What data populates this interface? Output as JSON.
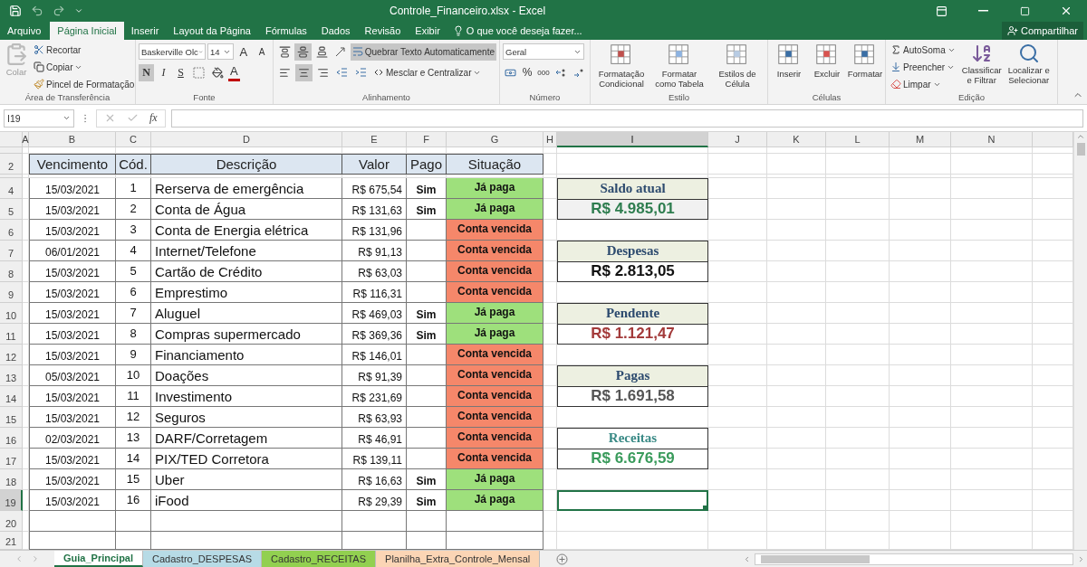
{
  "window": {
    "title": "Controle_Financeiro.xlsx - Excel"
  },
  "menu_tabs": [
    {
      "label": "Arquivo",
      "selected": false,
      "kind": "file"
    },
    {
      "label": "Página Inicial",
      "selected": true,
      "kind": "tab"
    },
    {
      "label": "Inserir",
      "selected": false,
      "kind": "tab"
    },
    {
      "label": "Layout da Página",
      "selected": false,
      "kind": "tab"
    },
    {
      "label": "Fórmulas",
      "selected": false,
      "kind": "tab"
    },
    {
      "label": "Dados",
      "selected": false,
      "kind": "tab"
    },
    {
      "label": "Revisão",
      "selected": false,
      "kind": "tab"
    },
    {
      "label": "Exibir",
      "selected": false,
      "kind": "tab"
    }
  ],
  "tell_me": "O que você deseja fazer...",
  "share": "Compartilhar",
  "ribbon": {
    "clipboard": {
      "paste": "Colar",
      "cut": "Recortar",
      "copy": "Copiar",
      "format_painter": "Pincel de Formatação",
      "label": "Área de Transferência"
    },
    "font": {
      "font_name": "Baskerville Olc",
      "font_size": "14",
      "grow_font": "A",
      "shrink_font": "A",
      "bold": {
        "label": "N",
        "selected": true
      },
      "italic": {
        "label": "I",
        "selected": false
      },
      "underline": {
        "label": "S",
        "selected": false
      },
      "font_color": "A",
      "label": "Fonte"
    },
    "alignment": {
      "vertical_align": [
        {
          "selected": false
        },
        {
          "selected": true
        },
        {
          "selected": false
        }
      ],
      "horizontal_align": [
        {
          "selected": false
        },
        {
          "selected": true
        },
        {
          "selected": false
        }
      ],
      "wrap_text": {
        "label": "Quebrar Texto Automaticamente",
        "selected": true
      },
      "merge": "Mesclar e Centralizar",
      "label": "Alinhamento"
    },
    "number": {
      "format": "Geral",
      "percent": "%",
      "thousands": "000",
      "label": "Número"
    },
    "styles": {
      "buttons": [
        "Formatação Condicional",
        "Formatar como Tabela",
        "Estilos de Célula"
      ],
      "label": "Estilo"
    },
    "cells": {
      "buttons": [
        "Inserir",
        "Excluir",
        "Formatar"
      ],
      "label": "Células"
    },
    "editing": {
      "autosum": "AutoSoma",
      "fill": "Preencher",
      "clear": "Limpar",
      "sort": "Classificar e Filtrar",
      "find": "Localizar e Selecionar",
      "label": "Edição"
    }
  },
  "formula_bar": {
    "name_box": "I19",
    "function_label": "fx"
  },
  "column_headers": [
    {
      "label": "A",
      "selected": false
    },
    {
      "label": "B",
      "selected": false
    },
    {
      "label": "C",
      "selected": false
    },
    {
      "label": "D",
      "selected": false
    },
    {
      "label": "E",
      "selected": false
    },
    {
      "label": "F",
      "selected": false
    },
    {
      "label": "G",
      "selected": false
    },
    {
      "label": "H",
      "selected": false
    },
    {
      "label": "I",
      "selected": true
    },
    {
      "label": "J",
      "selected": false
    },
    {
      "label": "K",
      "selected": false
    },
    {
      "label": "L",
      "selected": false
    },
    {
      "label": "M",
      "selected": false
    },
    {
      "label": "N",
      "selected": false
    }
  ],
  "row_headers": [
    {
      "label": "2",
      "selected": false
    },
    {
      "label": "4",
      "selected": false
    },
    {
      "label": "5",
      "selected": false
    },
    {
      "label": "6",
      "selected": false
    },
    {
      "label": "7",
      "selected": false
    },
    {
      "label": "8",
      "selected": false
    },
    {
      "label": "9",
      "selected": false
    },
    {
      "label": "10",
      "selected": false
    },
    {
      "label": "11",
      "selected": false
    },
    {
      "label": "12",
      "selected": false
    },
    {
      "label": "13",
      "selected": false
    },
    {
      "label": "14",
      "selected": false
    },
    {
      "label": "15",
      "selected": false
    },
    {
      "label": "16",
      "selected": false
    },
    {
      "label": "17",
      "selected": false
    },
    {
      "label": "18",
      "selected": false
    },
    {
      "label": "19",
      "selected": true
    },
    {
      "label": "20",
      "selected": false
    },
    {
      "label": "21",
      "selected": false
    }
  ],
  "table": {
    "columns": [
      "Vencimento",
      "Cód.",
      "Descrição",
      "Valor",
      "Pago",
      "Situação"
    ],
    "rows": [
      {
        "due": "15/03/2021",
        "code": "1",
        "description": "Rerserva de emergência",
        "value": "R$ 675,54",
        "paid": "Sim",
        "status": "Já paga",
        "kind": "paid"
      },
      {
        "due": "15/03/2021",
        "code": "2",
        "description": "Conta de Água",
        "value": "R$ 131,63",
        "paid": "Sim",
        "status": "Já paga",
        "kind": "paid"
      },
      {
        "due": "15/03/2021",
        "code": "3",
        "description": "Conta de Energia elétrica",
        "value": "R$ 131,96",
        "status": "Conta vencida",
        "kind": "overdue"
      },
      {
        "due": "06/01/2021",
        "code": "4",
        "description": "Internet/Telefone",
        "value": "R$ 91,13",
        "status": "Conta vencida",
        "kind": "overdue"
      },
      {
        "due": "15/03/2021",
        "code": "5",
        "description": "Cartão de Crédito",
        "value": "R$ 63,03",
        "status": "Conta vencida",
        "kind": "overdue"
      },
      {
        "due": "15/03/2021",
        "code": "6",
        "description": "Emprestimo",
        "value": "R$ 116,31",
        "status": "Conta vencida",
        "kind": "overdue"
      },
      {
        "due": "15/03/2021",
        "code": "7",
        "description": "Aluguel",
        "value": "R$ 469,03",
        "paid": "Sim",
        "status": "Já paga",
        "kind": "paid"
      },
      {
        "due": "15/03/2021",
        "code": "8",
        "description": "Compras supermercado",
        "value": "R$ 369,36",
        "paid": "Sim",
        "status": "Já paga",
        "kind": "paid"
      },
      {
        "due": "15/03/2021",
        "code": "9",
        "description": "Financiamento",
        "value": "R$ 146,01",
        "status": "Conta vencida",
        "kind": "overdue"
      },
      {
        "due": "05/03/2021",
        "code": "10",
        "description": "Doações",
        "value": "R$ 91,39",
        "status": "Conta vencida",
        "kind": "overdue"
      },
      {
        "due": "15/03/2021",
        "code": "11",
        "description": "Investimento",
        "value": "R$ 231,69",
        "status": "Conta vencida",
        "kind": "overdue"
      },
      {
        "due": "15/03/2021",
        "code": "12",
        "description": "Seguros",
        "value": "R$ 63,93",
        "status": "Conta vencida",
        "kind": "overdue"
      },
      {
        "due": "02/03/2021",
        "code": "13",
        "description": "DARF/Corretagem",
        "value": "R$ 46,91",
        "status": "Conta vencida",
        "kind": "overdue"
      },
      {
        "due": "15/03/2021",
        "code": "14",
        "description": "PIX/TED Corretora",
        "value": "R$ 139,11",
        "status": "Conta vencida",
        "kind": "overdue"
      },
      {
        "due": "15/03/2021",
        "code": "15",
        "description": "Uber",
        "value": "R$ 16,63",
        "paid": "Sim",
        "status": "Já paga",
        "kind": "paid"
      },
      {
        "due": "15/03/2021",
        "code": "16",
        "description": "iFood",
        "value": "R$ 29,39",
        "paid": "Sim",
        "status": "Já paga",
        "kind": "paid"
      }
    ]
  },
  "summary_cards": [
    {
      "title": "Saldo atual",
      "value": "R$ 4.985,01",
      "color": "#2e7d4f",
      "kind": "balance"
    },
    {
      "title": "Despesas",
      "value": "R$ 2.813,05",
      "color": "#111111",
      "kind": "total"
    },
    {
      "title": "Pendente",
      "value": "R$ 1.121,47",
      "color": "#a33a3a",
      "kind": "total"
    },
    {
      "title": "Pagas",
      "value": "R$ 1.691,58",
      "color": "#555555",
      "kind": "total"
    },
    {
      "title": "Receitas",
      "value": "R$ 6.676,59",
      "color": "#3a9b5c",
      "kind": "income"
    }
  ],
  "sheet_tabs": [
    {
      "label": "Guia_Principal",
      "selected": true,
      "color": "#ffffff"
    },
    {
      "label": "Cadastro_DESPESAS",
      "selected": false,
      "color": "#b7dbe6"
    },
    {
      "label": "Cadastro_RECEITAS",
      "selected": false,
      "color": "#92d050"
    },
    {
      "label": "Planilha_Extra_Controle_Mensal",
      "selected": false,
      "color": "#fbd5b5"
    }
  ]
}
